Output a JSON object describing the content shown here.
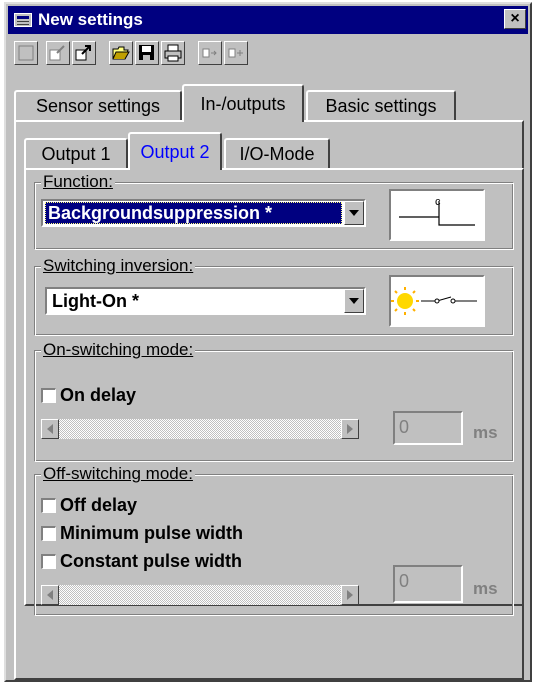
{
  "window": {
    "title": "New settings",
    "close_glyph": "×"
  },
  "toolbar": {
    "buttons": [
      "new-icon",
      "edit-icon",
      "export-icon",
      "open-folder-icon",
      "save-icon",
      "print-icon",
      "step-forward-icon",
      "add-icon"
    ]
  },
  "main_tabs": [
    "Sensor settings",
    "In-/outputs",
    "Basic settings"
  ],
  "main_tabs_active": "In-/outputs",
  "sub_tabs": [
    "Output 1",
    "Output 2",
    "I/O-Mode"
  ],
  "sub_tabs_active": "Output 2",
  "function": {
    "label": "Function:",
    "value": "Backgroundsuppression *",
    "diagram_label": "c"
  },
  "switching_inversion": {
    "label": "Switching inversion:",
    "value": "Light-On *"
  },
  "on_switching": {
    "label": "On-switching mode:",
    "on_delay_label": "On delay",
    "on_delay_checked": false,
    "value": "0",
    "unit": "ms"
  },
  "off_switching": {
    "label": "Off-switching mode:",
    "off_delay_label": "Off delay",
    "minimum_pulse_label": "Minimum pulse width",
    "constant_pulse_label": "Constant pulse width",
    "off_delay_checked": false,
    "minimum_pulse_checked": false,
    "constant_pulse_checked": false,
    "value": "0",
    "unit": "ms"
  },
  "colors": {
    "titlebar": "#000080",
    "face": "#c0c0c0",
    "active_sub_tab_text": "#0000ff"
  }
}
